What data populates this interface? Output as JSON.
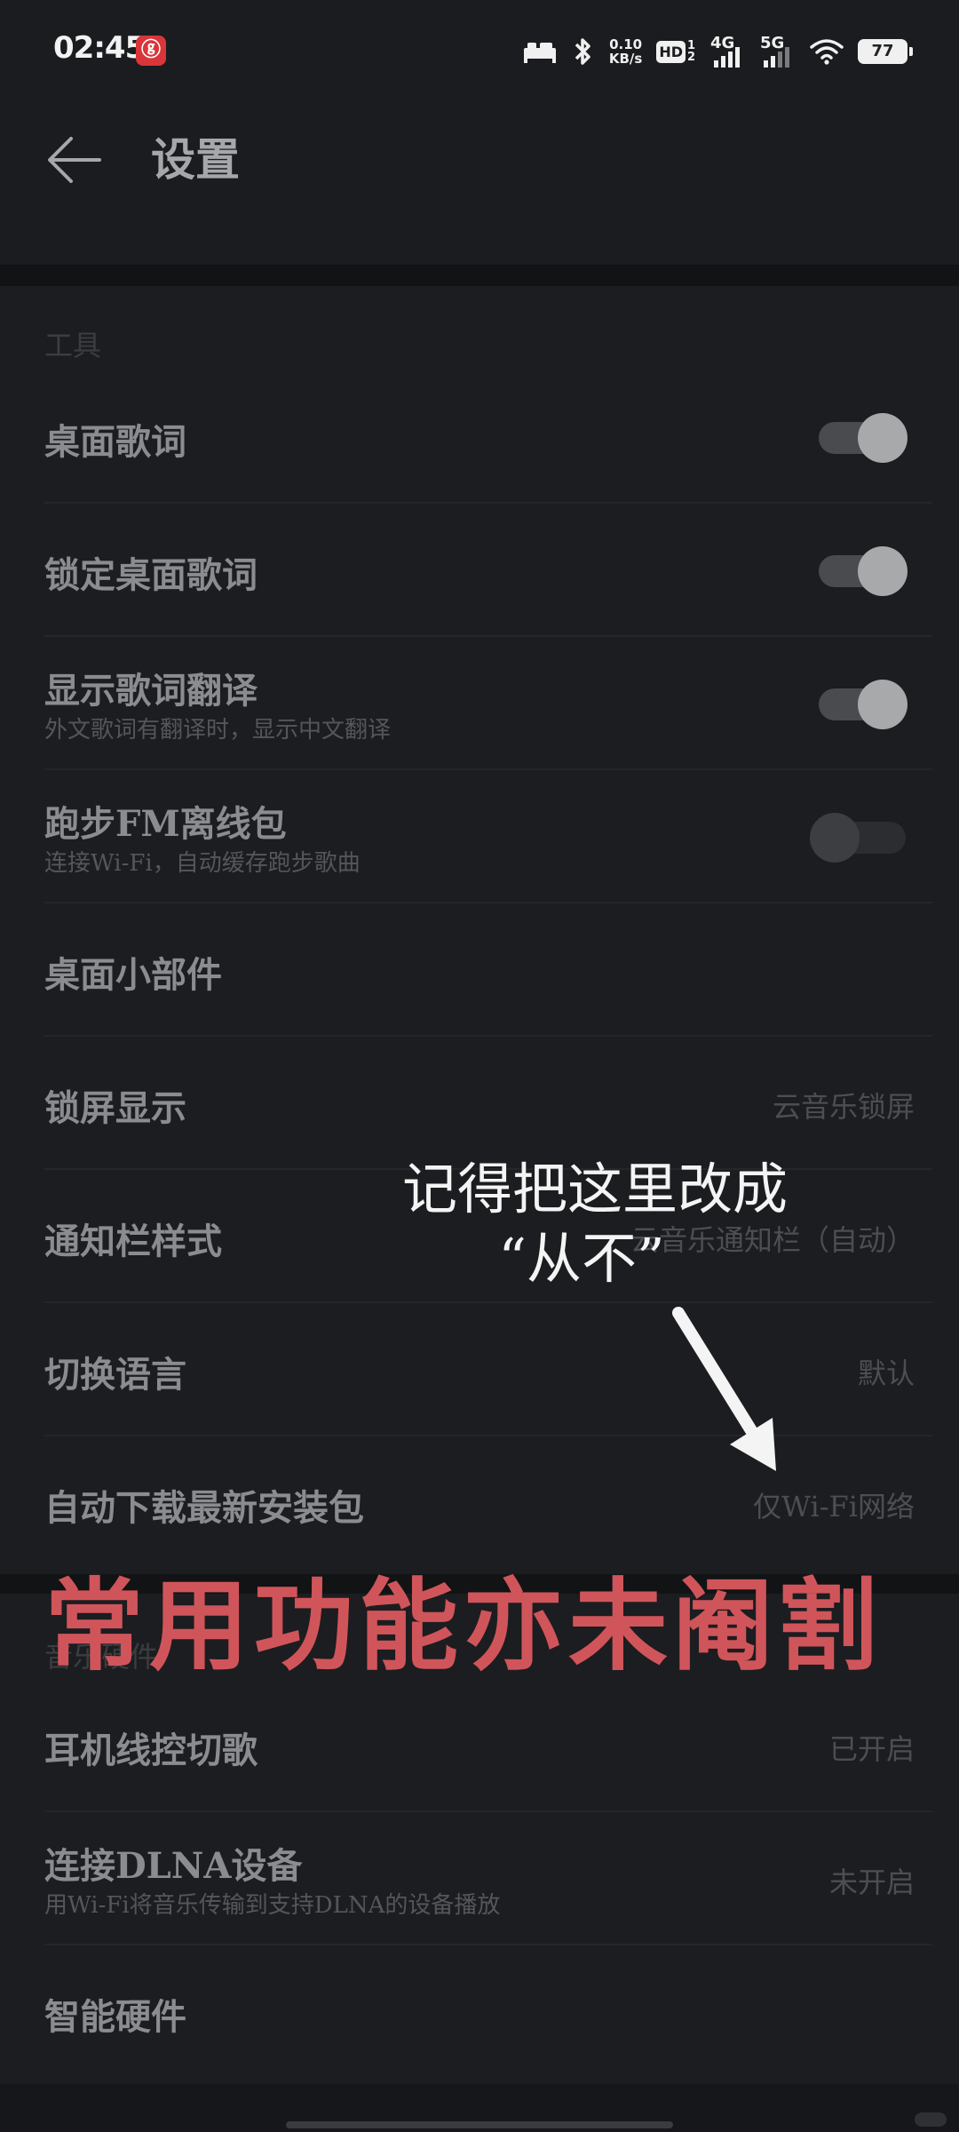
{
  "status_bar": {
    "time": "02:45",
    "app_badge": "ⓖ",
    "speed_value": "0.10",
    "speed_unit": "KB/s",
    "hd_label": "HD",
    "hd_sub": "1 2",
    "net1": "4G",
    "net2": "5G",
    "battery": "77"
  },
  "header": {
    "title": "设置"
  },
  "sections": {
    "tools": {
      "title": "工具",
      "rows": [
        {
          "label": "桌面歌词",
          "toggle": "on"
        },
        {
          "label": "锁定桌面歌词",
          "toggle": "on"
        },
        {
          "label": "显示歌词翻译",
          "sub": "外文歌词有翻译时，显示中文翻译",
          "toggle": "on"
        },
        {
          "label": "跑步FM离线包",
          "sub": "连接Wi-Fi，自动缓存跑步歌曲",
          "toggle": "off"
        },
        {
          "label": "桌面小部件"
        },
        {
          "label": "锁屏显示",
          "value": "云音乐锁屏"
        },
        {
          "label": "通知栏样式",
          "value": "云音乐通知栏（自动）"
        },
        {
          "label": "切换语言",
          "value": "默认"
        },
        {
          "label": "自动下载最新安装包",
          "value": "仅Wi-Fi网络"
        }
      ]
    },
    "hardware": {
      "title": "音乐硬件",
      "rows": [
        {
          "label": "耳机线控切歌",
          "value": "已开启"
        },
        {
          "label": "连接DLNA设备",
          "sub": "用Wi-Fi将音乐传输到支持DLNA的设备播放",
          "value": "未开启"
        },
        {
          "label": "智能硬件"
        }
      ]
    }
  },
  "overlay": {
    "note_line1": "记得把这里改成",
    "note_line2": "“从不”",
    "banner": "常用功能亦未阉割"
  }
}
